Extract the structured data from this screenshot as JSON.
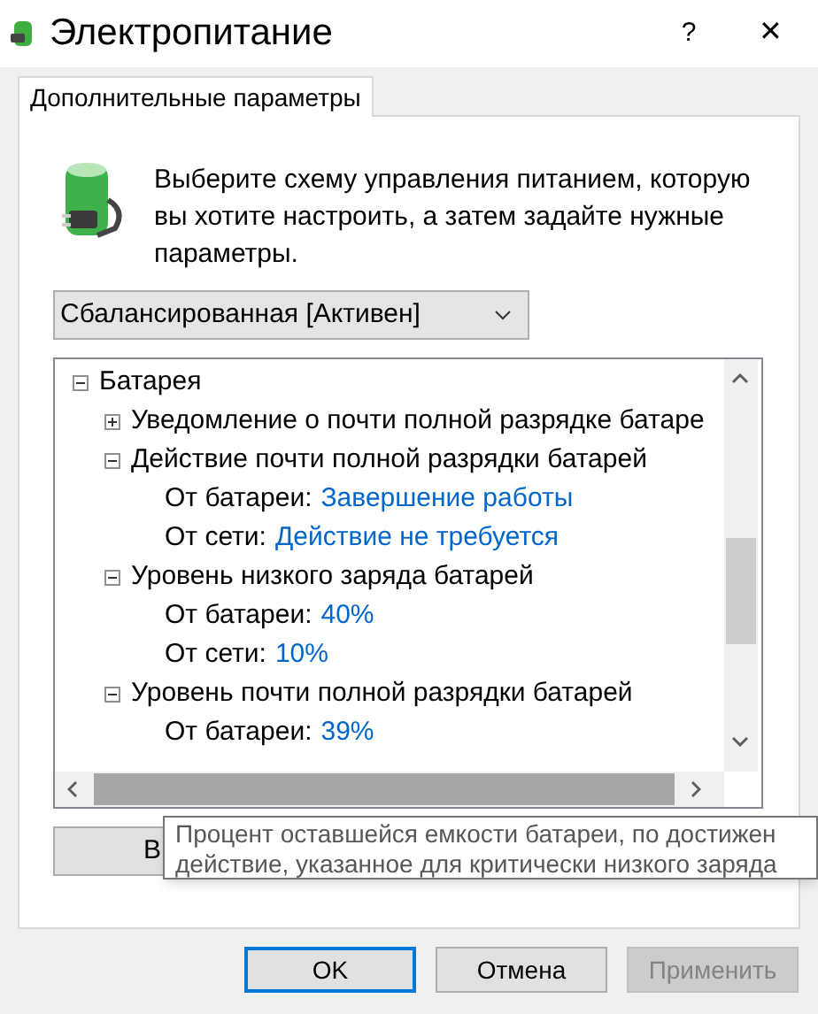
{
  "window": {
    "title": "Электропитание",
    "help_button": "?",
    "close_button": "✕"
  },
  "tabs": [
    {
      "label": "Дополнительные параметры",
      "selected": true
    }
  ],
  "intro": "Выберите схему управления питанием, которую вы хотите настроить, а затем задайте нужные параметры.",
  "plan_dropdown": {
    "value": "Сбалансированная [Активен]"
  },
  "tree": [
    {
      "label": "Батарея",
      "expanded": true,
      "children": [
        {
          "label": "Уведомление о почти полной разрядке батаре",
          "expanded": false
        },
        {
          "label": "Действие почти полной разрядки батарей",
          "expanded": true,
          "settings": [
            {
              "label": "От батареи:",
              "value": "Завершение работы"
            },
            {
              "label": "От сети:",
              "value": "Действие не требуется"
            }
          ]
        },
        {
          "label": "Уровень низкого заряда батарей",
          "expanded": true,
          "settings": [
            {
              "label": "От батареи:",
              "value": "40%"
            },
            {
              "label": "От сети:",
              "value": "10%"
            }
          ]
        },
        {
          "label": "Уровень почти полной разрядки батарей",
          "expanded": true,
          "settings": [
            {
              "label": "От батареи:",
              "value": "39%"
            }
          ]
        }
      ]
    }
  ],
  "restore_button": "В",
  "tooltip": [
    "Процент оставшейся емкости батареи, по достижен",
    "действие, указанное для критически низкого заряда"
  ],
  "buttons": [
    {
      "label": "OK",
      "default": true,
      "disabled": false
    },
    {
      "label": "Отмена",
      "default": false,
      "disabled": false
    },
    {
      "label": "Применить",
      "default": false,
      "disabled": true
    }
  ]
}
